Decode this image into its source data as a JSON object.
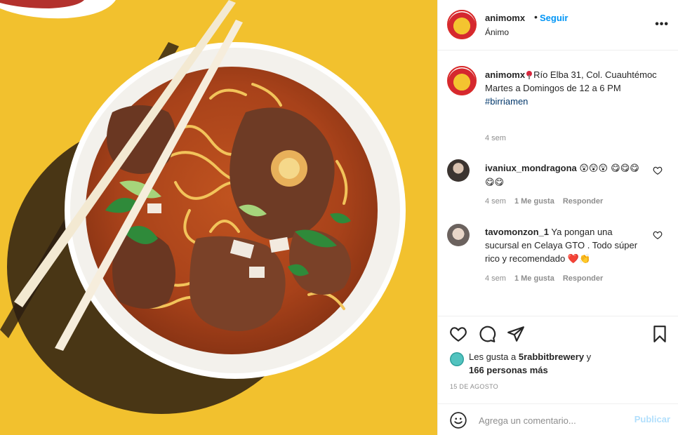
{
  "header": {
    "username": "animomx",
    "dot": "•",
    "follow_label": "Seguir",
    "subtitle": "Ánimo",
    "more_icon": "more-horizontal-icon"
  },
  "caption": {
    "username": "animomx",
    "line1": "Río Elba 31, Col. Cuauhtémoc",
    "line2": "Martes a Domingos de 12 a 6 PM",
    "hashtag": "#birriamen",
    "time": "4 sem"
  },
  "comments": [
    {
      "username": "ivaniux_mondragona",
      "emoji_line": "😲😲😲 😋😋😋😋😋",
      "time": "4 sem",
      "likes": "1 Me gusta",
      "reply": "Responder"
    },
    {
      "username": "tavomonzon_1",
      "text": "Ya pongan una sucursal en Celaya GTO . Todo súper rico y recomendado",
      "emoji": "❤️👏",
      "time": "4 sem",
      "likes": "1 Me gusta",
      "reply": "Responder"
    }
  ],
  "likes": {
    "prefix": "Les gusta a",
    "user": "5rabbitbrewery",
    "conj": "y",
    "others": "166 personas más"
  },
  "date": "15 DE AGOSTO",
  "add_comment": {
    "placeholder": "Agrega un comentario...",
    "publish_label": "Publicar"
  },
  "colors": {
    "accent_blue": "#0095f6",
    "photo_background": "#f2c12e",
    "publish_disabled": "#b2dffc"
  }
}
